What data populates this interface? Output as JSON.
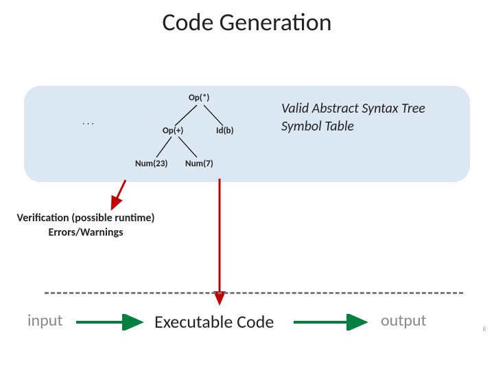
{
  "title": "Code Generation",
  "tree": {
    "root": "Op(*)",
    "left": "Op(+)",
    "right": "Id(b)",
    "ll": "Num(23)",
    "lr": "Num(7)"
  },
  "ellipsis": ". . .",
  "annotation": {
    "line1": "Valid Abstract Syntax Tree",
    "line2": "Symbol Table"
  },
  "verification": {
    "line1": "Verification (possible runtime)",
    "line2": "Errors/Warnings"
  },
  "exec": "Executable Code",
  "input": "input",
  "output": "output",
  "page": "8",
  "colors": {
    "arrow_red": "#c00000",
    "arrow_green": "#008040",
    "box": "#dbe7f3"
  }
}
